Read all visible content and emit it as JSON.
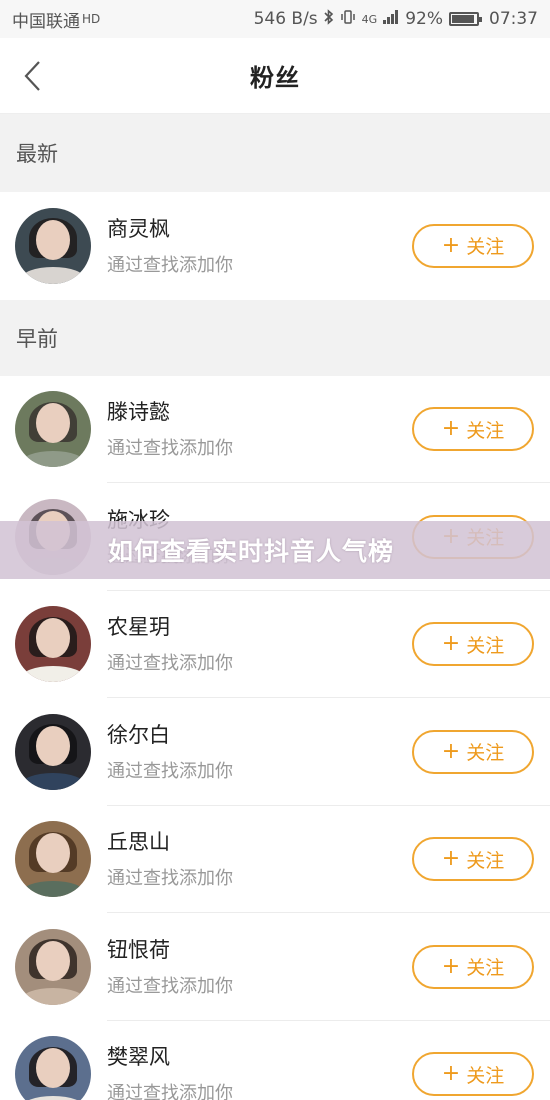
{
  "status_bar": {
    "carrier": "中国联通",
    "hd_label": "HD",
    "net_speed": "546 B/s",
    "network_type": "4G",
    "battery": "92%",
    "battery_level": 0.92,
    "time": "07:37"
  },
  "header": {
    "title": "粉丝"
  },
  "sections": [
    {
      "title": "最新",
      "items": [
        {
          "name": "商灵枫",
          "source": "通过查找添加你",
          "follow_label": "关注"
        }
      ]
    },
    {
      "title": "早前",
      "items": [
        {
          "name": "滕诗懿",
          "source": "通过查找添加你",
          "follow_label": "关注"
        },
        {
          "name": "施冰珍",
          "source": "通过查找添加你",
          "follow_label": "关注"
        },
        {
          "name": "农星玥",
          "source": "通过查找添加你",
          "follow_label": "关注"
        },
        {
          "name": "徐尔白",
          "source": "通过查找添加你",
          "follow_label": "关注"
        },
        {
          "name": "丘思山",
          "source": "通过查找添加你",
          "follow_label": "关注"
        },
        {
          "name": "钮恨荷",
          "source": "通过查找添加你",
          "follow_label": "关注"
        },
        {
          "name": "樊翠风",
          "source": "通过查找添加你",
          "follow_label": "关注"
        }
      ]
    }
  ],
  "overlay": {
    "text": "如何查看实时抖音人气榜"
  },
  "colors": {
    "accent": "#ee9a1d",
    "follow_border": "#f0a630"
  },
  "icons": {
    "back": "chevron-left-icon",
    "follow": "plus-icon",
    "bluetooth": "bluetooth-icon",
    "vibrate": "vibrate-icon",
    "signal": "signal-icon",
    "battery": "battery-icon"
  }
}
